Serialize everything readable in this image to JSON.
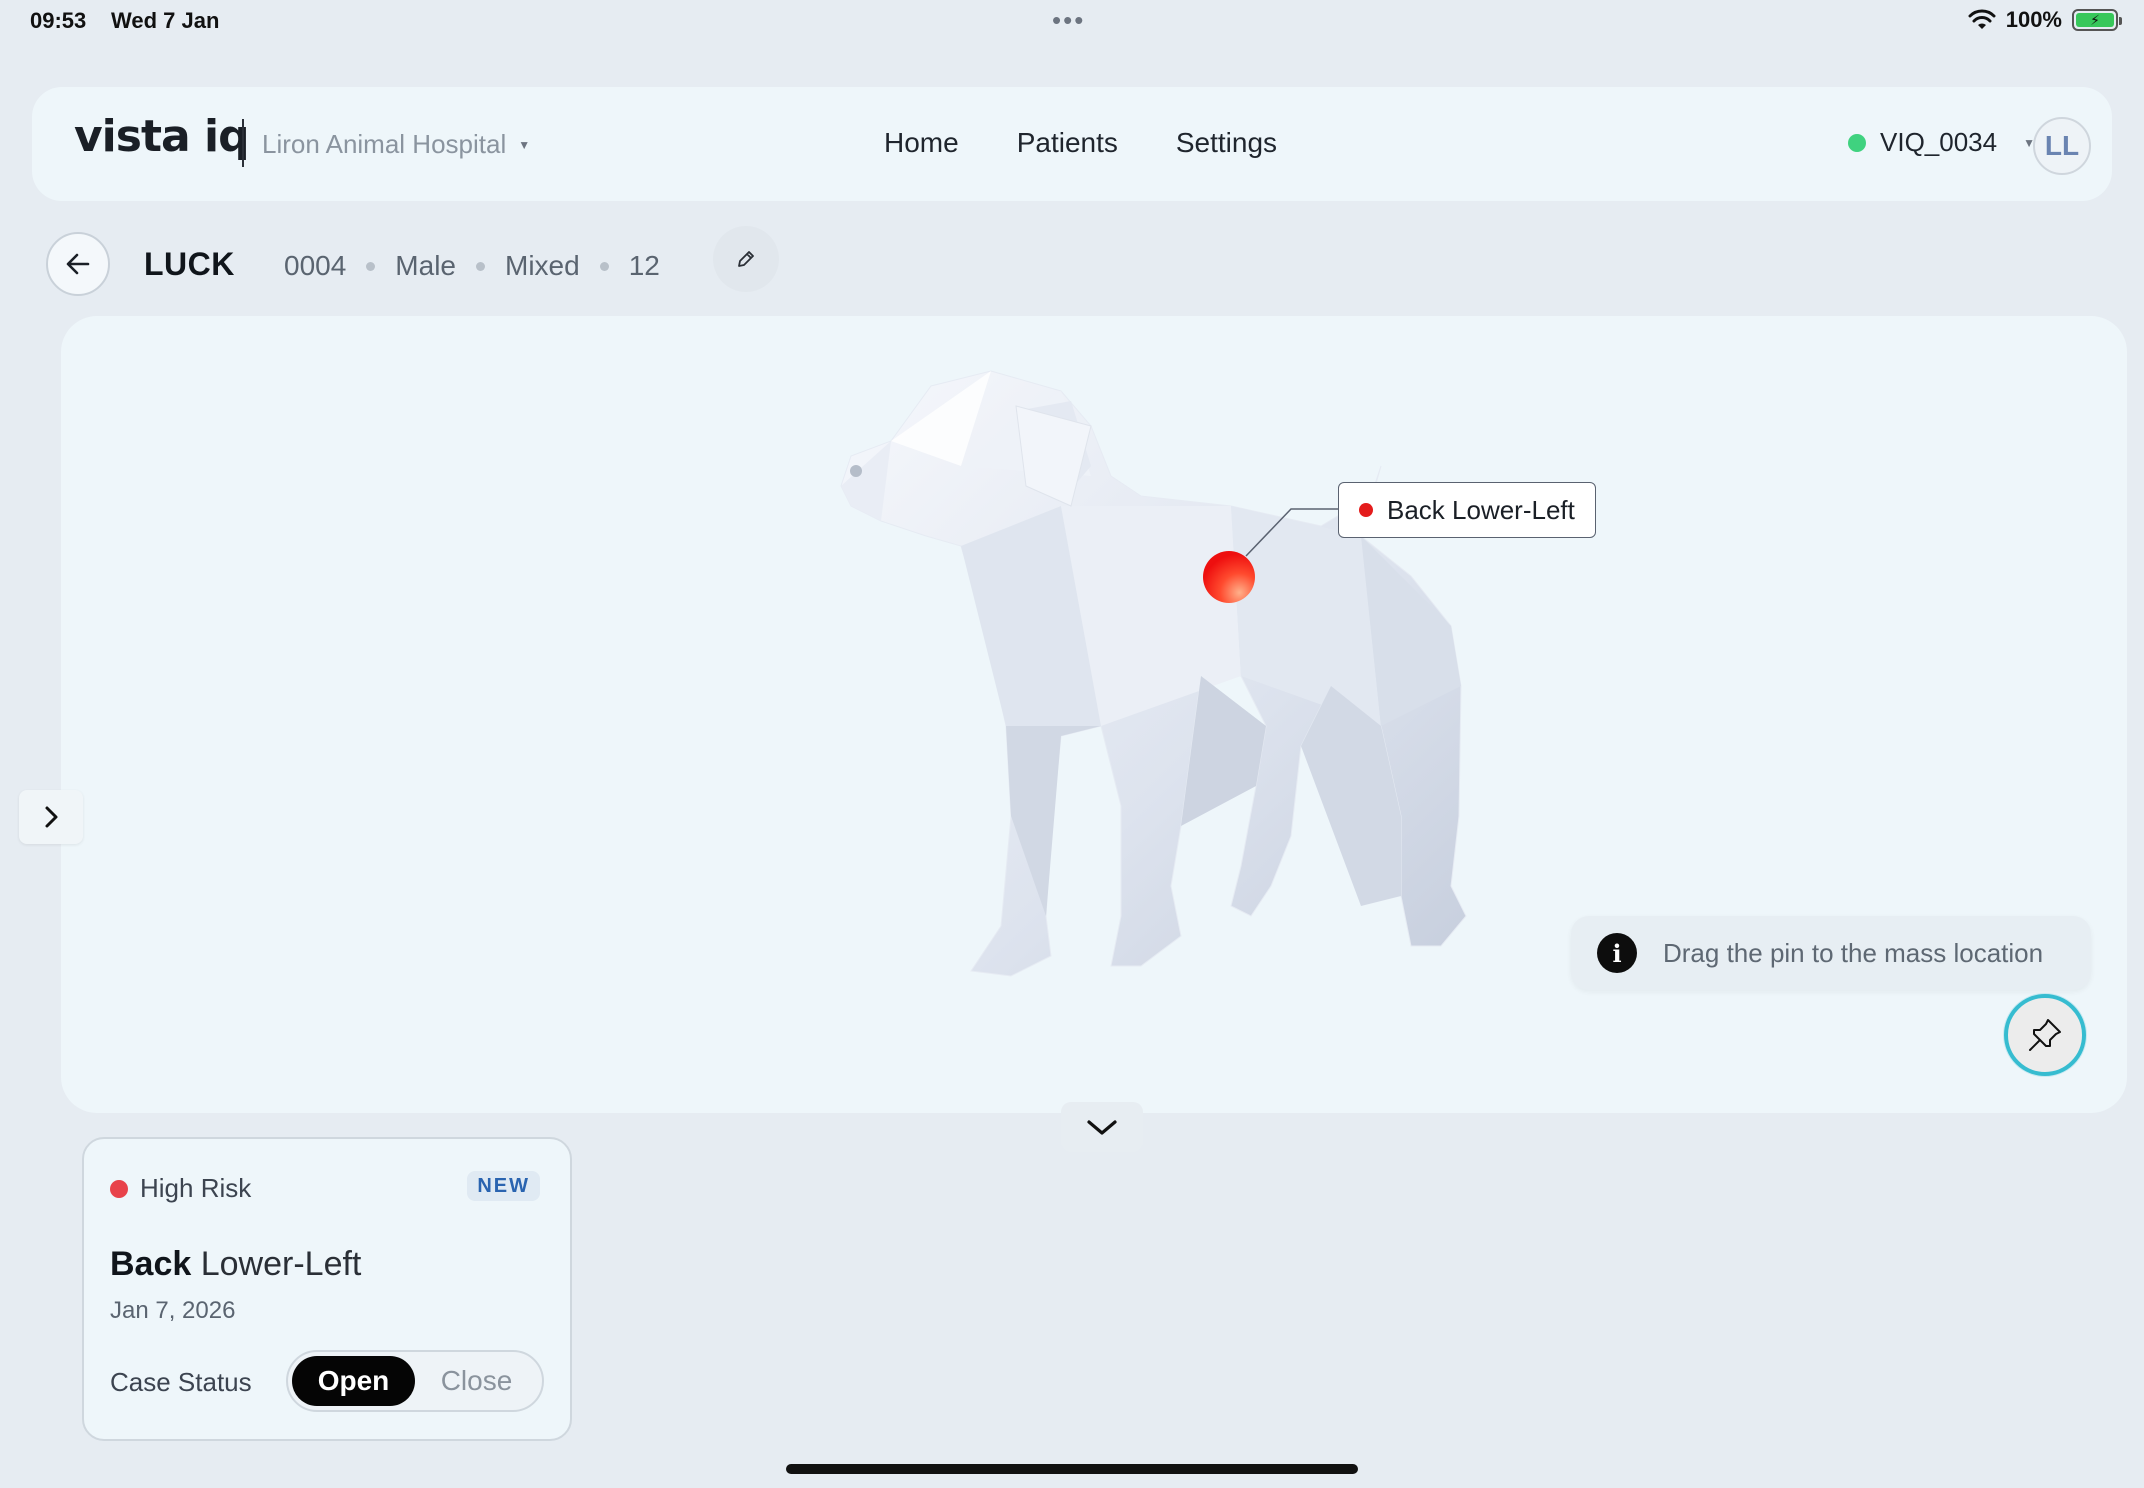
{
  "status_bar": {
    "time": "09:53",
    "date": "Wed 7 Jan",
    "battery": "100%"
  },
  "nav": {
    "logo": "vista iq",
    "hospital": "Liron Animal Hospital",
    "links": [
      "Home",
      "Patients",
      "Settings"
    ],
    "device": "VIQ_0034",
    "device_status_color": "#3fd27f",
    "avatar_initials": "LL"
  },
  "patient": {
    "name": "LUCK",
    "meta": [
      "0004",
      "Male",
      "Mixed",
      "12"
    ]
  },
  "viewer": {
    "pin_label": "Back Lower-Left",
    "tip_text": "Drag the pin to the mass location",
    "info_glyph": "i"
  },
  "case": {
    "risk": "High Risk",
    "risk_color": "#e8424a",
    "badge": "NEW",
    "title_bold": "Back",
    "title_rest": " Lower-Left",
    "date": "Jan 7, 2026",
    "status_label": "Case Status",
    "options": [
      "Open",
      "Close"
    ],
    "selected": "Open"
  },
  "icons": {
    "back": "arrow-left-icon",
    "edit": "pencil-icon",
    "sidebar": "chevron-right-icon",
    "collapse": "chevron-down-icon",
    "pin": "pushpin-icon",
    "info": "info-icon",
    "wifi": "wifi-icon",
    "battery": "battery-icon"
  }
}
